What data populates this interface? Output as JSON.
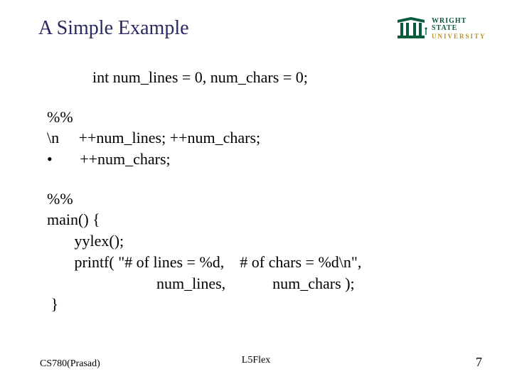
{
  "title": "A Simple Example",
  "logo": {
    "line1": "WRIGHT STATE",
    "line2": "UNIVERSITY"
  },
  "code": {
    "decl": "int num_lines = 0, num_chars = 0;",
    "block1": "%%\n\\n     ++num_lines; ++num_chars;\n•       ++num_chars;",
    "block2": "%%\nmain() {\n       yylex();\n       printf( \"# of lines = %d,    # of chars = %d\\n\",\n                            num_lines,            num_chars );\n }"
  },
  "footer": {
    "left": "CS780(Prasad)",
    "center": "L5Flex",
    "right": "7"
  }
}
